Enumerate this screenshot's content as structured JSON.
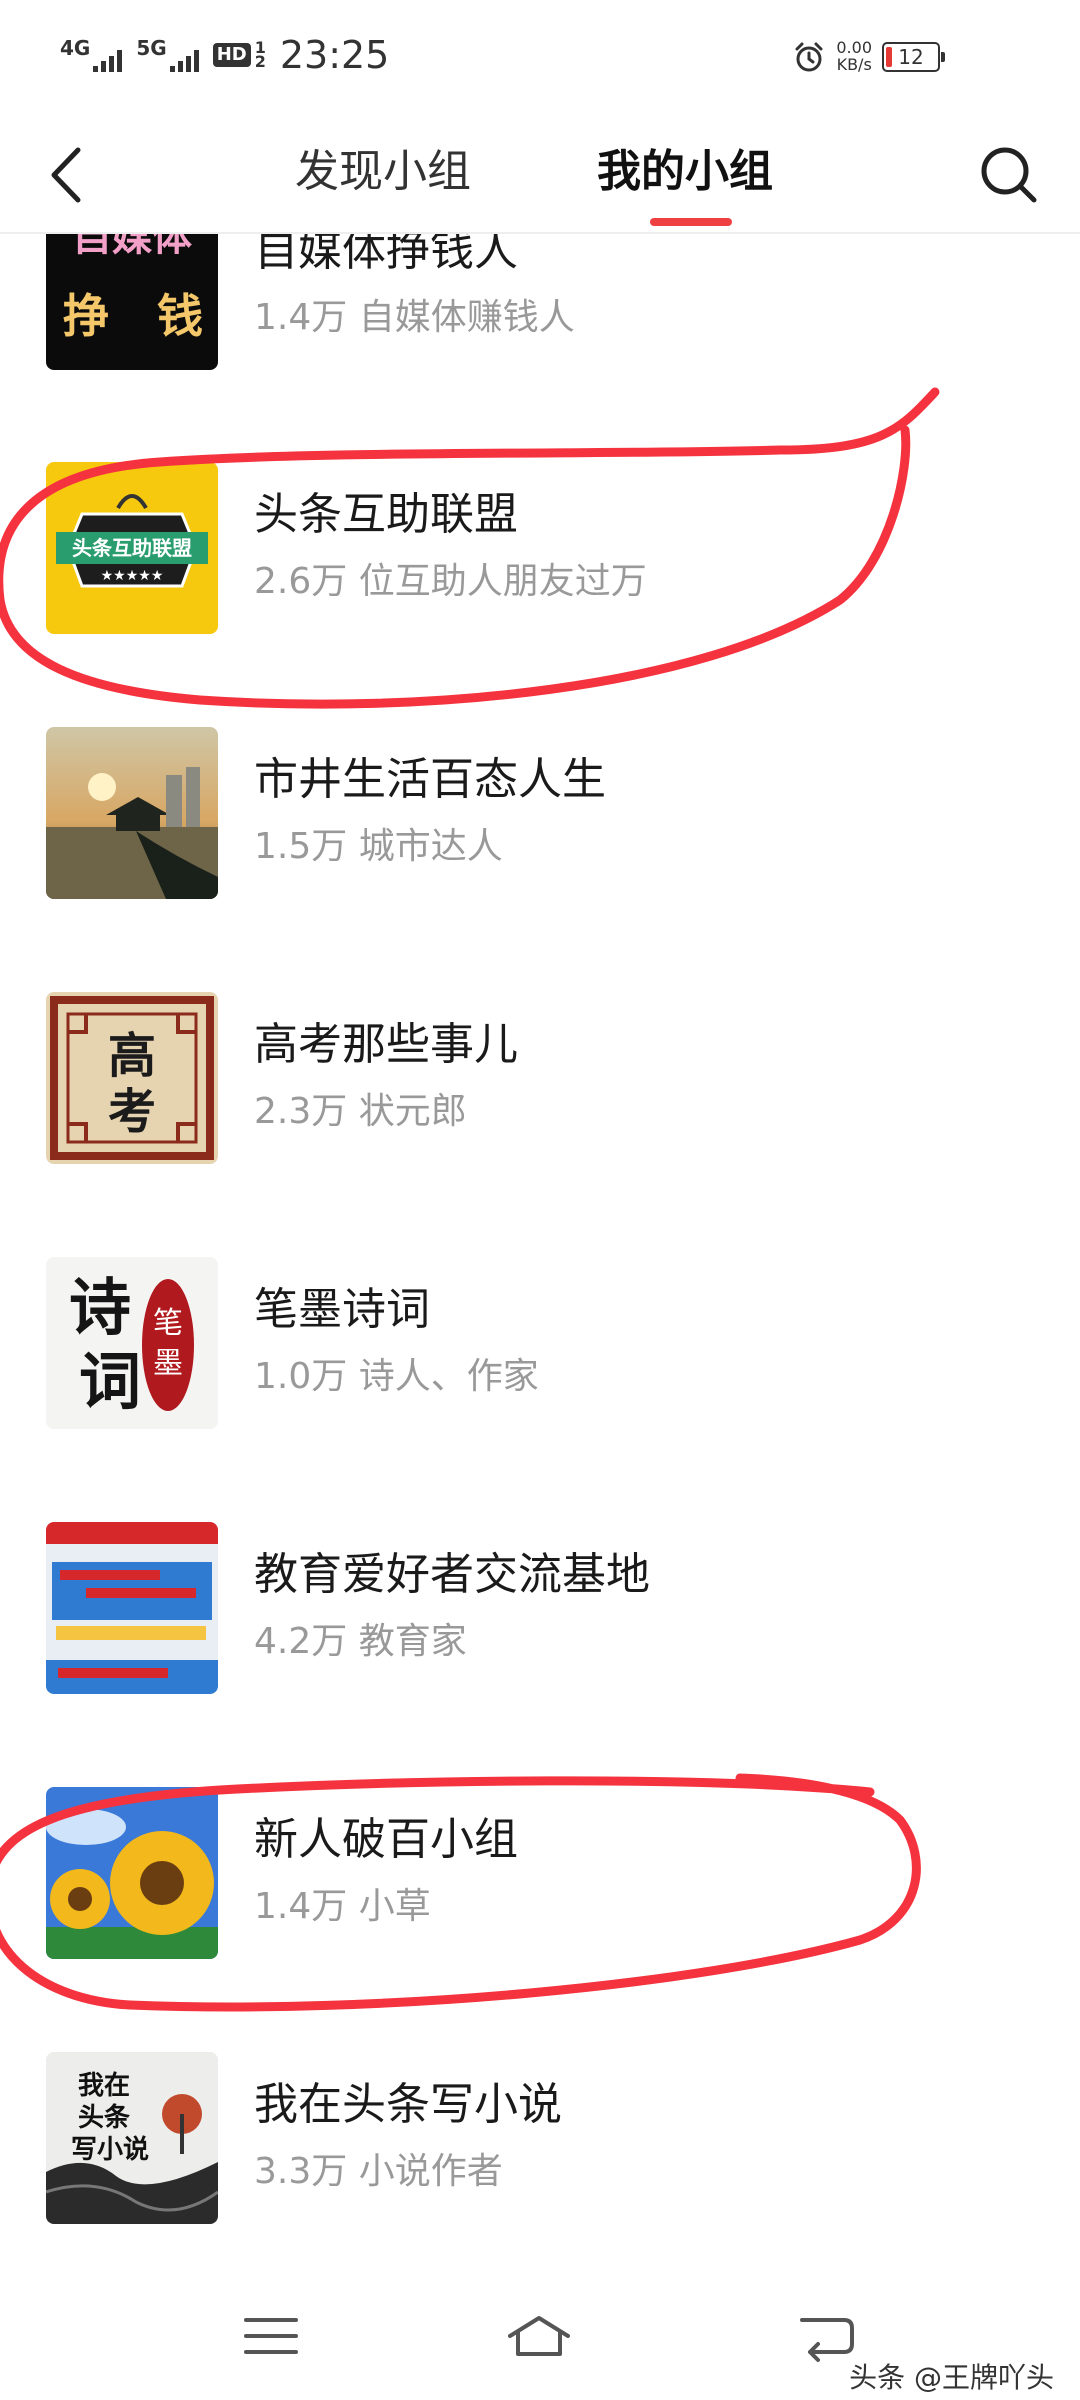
{
  "status_bar": {
    "net1": "4G",
    "net2": "5G",
    "hd": "HD",
    "hd_sub1": "1",
    "hd_sub2": "2",
    "time": "23:25",
    "speed_value": "0.00",
    "speed_unit": "KB/s",
    "battery": "12"
  },
  "nav": {
    "tabs": [
      {
        "label": "发现小组"
      },
      {
        "label": "我的小组"
      }
    ],
    "active_tab": "我的小组",
    "accent_color": "#f04142"
  },
  "groups": [
    {
      "name": "自媒体挣钱人",
      "count": "1.4万",
      "meta": "自媒体赚钱人",
      "thumb_text": [
        "自媒体",
        "挣",
        "钱"
      ]
    },
    {
      "name": "头条互助联盟",
      "count": "2.6万",
      "meta": "位互助人朋友过万",
      "thumb_text": [
        "头条互助联盟"
      ]
    },
    {
      "name": "市井生活百态人生",
      "count": "1.5万",
      "meta": "城市达人"
    },
    {
      "name": "高考那些事儿",
      "count": "2.3万",
      "meta": "状元郎",
      "thumb_text": [
        "高",
        "考"
      ]
    },
    {
      "name": "笔墨诗词",
      "count": "1.0万",
      "meta": "诗人、作家",
      "thumb_text": [
        "诗",
        "词",
        "笔",
        "墨"
      ]
    },
    {
      "name": "教育爱好者交流基地",
      "count": "4.2万",
      "meta": "教育家"
    },
    {
      "name": "新人破百小组",
      "count": "1.4万",
      "meta": "小草"
    },
    {
      "name": "我在头条写小说",
      "count": "3.3万",
      "meta": "小说作者",
      "thumb_text": [
        "我在",
        "头条",
        "写小说"
      ]
    }
  ],
  "watermark": "头条 @王牌吖头",
  "annotation_color": "#f5333f"
}
